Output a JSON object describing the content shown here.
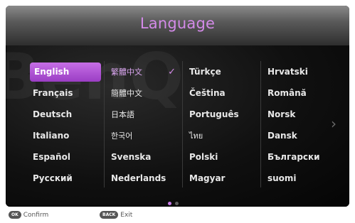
{
  "header": {
    "title": "Language"
  },
  "languages": {
    "col0": [
      "English",
      "Français",
      "Deutsch",
      "Italiano",
      "Español",
      "Русский"
    ],
    "col1": [
      "繁體中文",
      "簡體中文",
      "日本語",
      "한국어",
      "Svenska",
      "Nederlands"
    ],
    "col2": [
      "Türkçe",
      "Čeština",
      "Português",
      "ไทย",
      "Polski",
      "Magyar"
    ],
    "col3": [
      "Hrvatski",
      "Română",
      "Norsk",
      "Dansk",
      "Български",
      "suomi"
    ]
  },
  "selected_language": "English",
  "current_language": "繁體中文",
  "check_glyph": "✓",
  "page_indicator": {
    "pages": 2,
    "current": 1
  },
  "next_arrow": "›",
  "footer": {
    "ok_key": "OK",
    "ok_label": "Confirm",
    "back_key": "BACK",
    "back_label": "Exit"
  },
  "colors": {
    "accent": "#c66ee6",
    "title": "#d38ae8"
  }
}
